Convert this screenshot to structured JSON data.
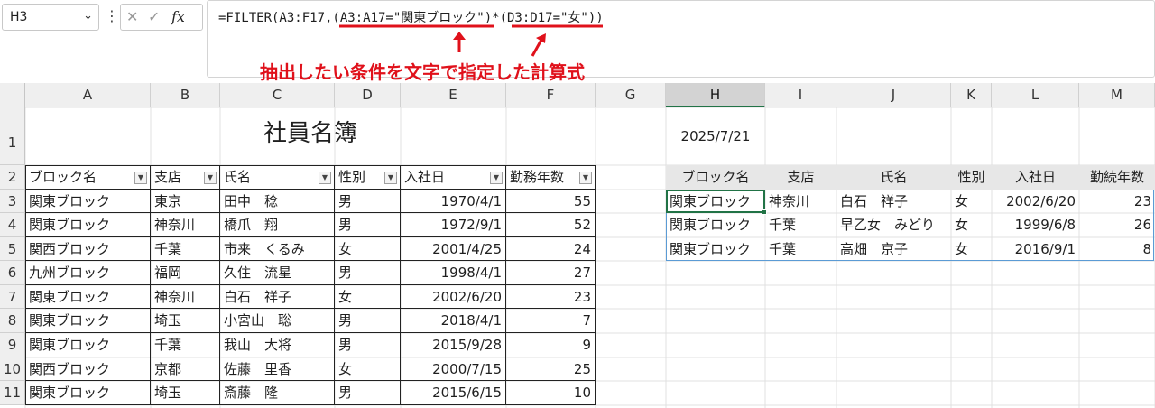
{
  "formula_bar": {
    "name_box": "H3",
    "fx": "fx",
    "formula": "=FILTER(A3:F17,(A3:A17=\"関東ブロック\")*(D3:D17=\"女\"))"
  },
  "annotation": "抽出したい条件を文字で指定した計算式",
  "columns": [
    "A",
    "B",
    "C",
    "D",
    "E",
    "F",
    "G",
    "H",
    "I",
    "J",
    "K",
    "L",
    "M"
  ],
  "rows": [
    "1",
    "2",
    "3",
    "4",
    "5",
    "6",
    "7",
    "8",
    "9",
    "10",
    "11"
  ],
  "sheet": {
    "title": "社員名簿",
    "headers": [
      "ブロック名",
      "支店",
      "氏名",
      "性別",
      "入社日",
      "勤務年数"
    ],
    "records": [
      [
        "関東ブロック",
        "東京",
        "田中　稔",
        "男",
        "1970/4/1",
        "55"
      ],
      [
        "関東ブロック",
        "神奈川",
        "橋爪　翔",
        "男",
        "1972/9/1",
        "52"
      ],
      [
        "関西ブロック",
        "千葉",
        "市来　くるみ",
        "女",
        "2001/4/25",
        "24"
      ],
      [
        "九州ブロック",
        "福岡",
        "久住　流星",
        "男",
        "1998/4/1",
        "27"
      ],
      [
        "関東ブロック",
        "神奈川",
        "白石　祥子",
        "女",
        "2002/6/20",
        "23"
      ],
      [
        "関東ブロック",
        "埼玉",
        "小宮山　聡",
        "男",
        "2018/4/1",
        "7"
      ],
      [
        "関東ブロック",
        "千葉",
        "我山　大将",
        "男",
        "2015/9/28",
        "9"
      ],
      [
        "関西ブロック",
        "京都",
        "佐藤　里香",
        "女",
        "2000/7/15",
        "25"
      ],
      [
        "関東ブロック",
        "埼玉",
        "斎藤　隆",
        "男",
        "2015/6/15",
        "10"
      ]
    ]
  },
  "result": {
    "date": "2025/7/21",
    "headers": [
      "ブロック名",
      "支店",
      "氏名",
      "性別",
      "入社日",
      "勤続年数"
    ],
    "records": [
      [
        "関東ブロック",
        "神奈川",
        "白石　祥子",
        "女",
        "2002/6/20",
        "23"
      ],
      [
        "関東ブロック",
        "千葉",
        "早乙女　みどり",
        "女",
        "1999/6/8",
        "26"
      ],
      [
        "関東ブロック",
        "千葉",
        "高畑　京子",
        "女",
        "2016/9/1",
        "8"
      ]
    ]
  },
  "colors": {
    "accent_red": "#e0111b",
    "excel_green": "#217346",
    "spill_blue": "#5b9bd5"
  }
}
